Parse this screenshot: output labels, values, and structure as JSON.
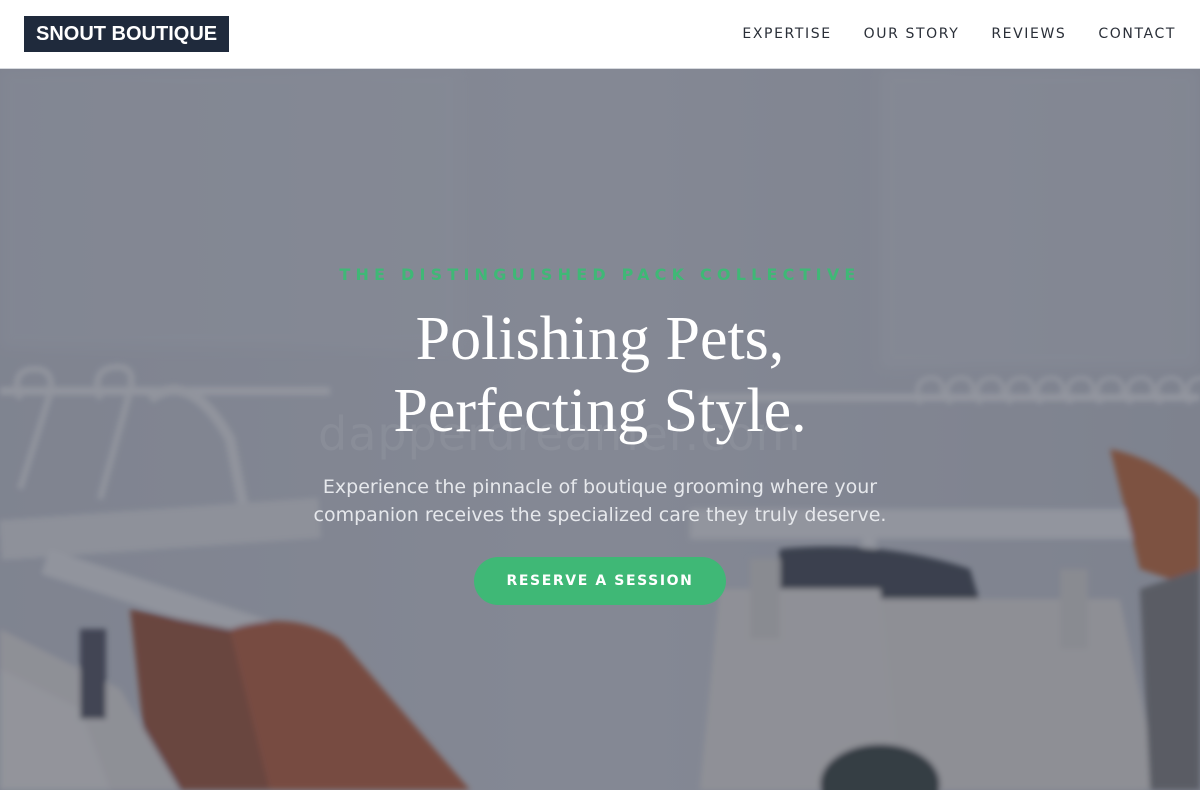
{
  "header": {
    "logo": "SNOUT BOUTIQUE",
    "nav": [
      {
        "label": "EXPERTISE"
      },
      {
        "label": "OUR STORY"
      },
      {
        "label": "REVIEWS"
      },
      {
        "label": "CONTACT"
      }
    ]
  },
  "hero": {
    "eyebrow": "THE DISTINGUISHED PACK COLLECTIVE",
    "headline_line1": "Polishing Pets,",
    "headline_line2": "Perfecting Style.",
    "subtext": "Experience the pinnacle of boutique grooming where your companion receives the specialized care they truly deserve.",
    "cta_label": "RESERVE A SESSION",
    "watermark": "dapperdreamer.com"
  },
  "colors": {
    "accent": "#3fb876",
    "brand_dark": "#1f2a3c",
    "overlay": "#3c4252"
  }
}
